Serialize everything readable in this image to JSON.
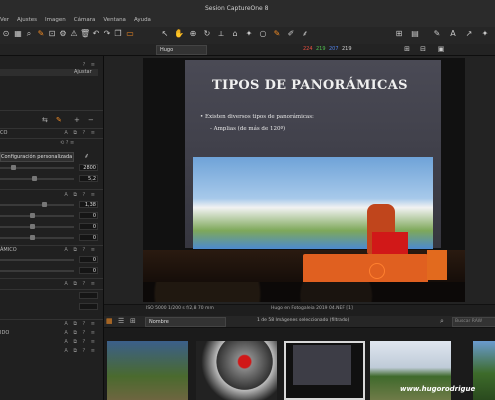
{
  "window": {
    "title": "Sesion CaptureOne 8"
  },
  "menu": [
    "Ver",
    "Ajustes",
    "Imagen",
    "Cámara",
    "Ventana",
    "Ayuda"
  ],
  "toolbar": {
    "left_icons": [
      "capture-icon",
      "grid-icon",
      "loupe-icon",
      "brush-icon",
      "crop-icon",
      "gear-icon",
      "warning-icon",
      "trash-icon",
      "undo-icon",
      "redo-icon",
      "copy-icon",
      "folders-icon"
    ],
    "right_icons": [
      "layout-icon",
      "exposure-icon",
      "edit-icon",
      "help-icon",
      "grid2-icon",
      "cursor-icon",
      "pan-icon",
      "zoom-icon"
    ]
  },
  "viewer_toolbar": {
    "preset_name": "Hugo",
    "rgb": {
      "r": "224",
      "g": "219",
      "b": "207",
      "k": "219"
    },
    "colors": {
      "r": "#e85040",
      "g": "#50c050",
      "b": "#5080e8",
      "k": "#d0d0d0"
    }
  },
  "left_panel": {
    "button_ajustar": "Ajustar",
    "section1": "CO",
    "preset_select": "Configuración personalizada",
    "value_2800": "2800",
    "value_5_2": "5,2",
    "value_1_38": "1,38",
    "value_zero1": "0",
    "value_zero2": "0",
    "value_zero3": "0",
    "section2": "ÁMICO",
    "value_zero4": "0",
    "value_zero5": "0",
    "section3": "IDO"
  },
  "photo": {
    "slide_title": "TIPOS DE PANORÁMICAS",
    "bullet1": "• Existen diversos tipos de panorámicas:",
    "bullet2": "- Amplias (de más de 120º)"
  },
  "status": {
    "left": "ISO 5000 1/200 s f/2,8 70 mm",
    "right": "Hugo en Fotogaleia 2019 04.NEF [1]"
  },
  "browser": {
    "sort": "Nombre",
    "count": "1 de 58 Imágenes seleccionado (filtrado)",
    "search_placeholder": "Buscar RAW"
  },
  "watermark": "www.hugorodrigue"
}
